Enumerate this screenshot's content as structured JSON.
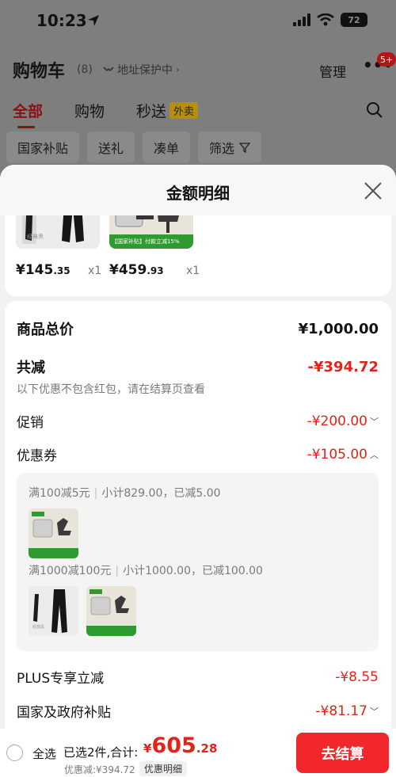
{
  "status_bar": {
    "time": "10:23",
    "battery": "72"
  },
  "header": {
    "title": "购物车",
    "count": "(8)",
    "address_label": "地址保护中",
    "manage_label": "管理",
    "more_badge": "5+"
  },
  "tabs": [
    {
      "label": "全部",
      "active": true
    },
    {
      "label": "购物",
      "active": false
    },
    {
      "label": "秒送",
      "active": false,
      "tag": "外卖"
    }
  ],
  "filters": [
    "国家补贴",
    "送礼",
    "凑单",
    "筛选"
  ],
  "sheet": {
    "title": "金额明细",
    "products": [
      {
        "price_int": "¥145",
        "price_dec": ".35",
        "qty": "x1",
        "thumb_caption": "经典黑"
      },
      {
        "price_int": "¥459",
        "price_dec": ".93",
        "qty": "x1",
        "banner_text": "【国家补贴】付款立减15%"
      }
    ],
    "rows": {
      "subtotal": {
        "label": "商品总价",
        "value": "¥1,000.00"
      },
      "total_discount": {
        "label": "共减",
        "value": "-¥394.72",
        "note": "以下优惠不包含红包，请在结算页查看"
      },
      "promotion": {
        "label": "促销",
        "value": "-¥200.00"
      },
      "coupon": {
        "label": "优惠券",
        "value": "-¥105.00"
      },
      "plus": {
        "label": "PLUS专享立减",
        "value": "-¥8.55"
      },
      "subsidy": {
        "label": "国家及政府补贴",
        "value": "-¥81.17"
      }
    },
    "coupon_details": [
      {
        "rule": "满100减5元",
        "detail": "小计829.00，已减5.00"
      },
      {
        "rule": "满1000减100元",
        "detail": "小计1000.00，已减100.00"
      }
    ],
    "thumb_caption": "经典黑"
  },
  "bottom_bar": {
    "select_all_label": "全选",
    "selected_text": "已选2件,合计:",
    "total_yen": "¥",
    "total_int": "605",
    "total_dec": ".28",
    "discount_text": "优惠减:¥394.72",
    "detail_tag": "优惠明细",
    "checkout_label": "去结算"
  },
  "colors": {
    "accent_red": "#e2231a",
    "checkout_red": "#f2272b",
    "tab_active": "#8a1111",
    "subsidy_green": "#2f9a2f"
  }
}
